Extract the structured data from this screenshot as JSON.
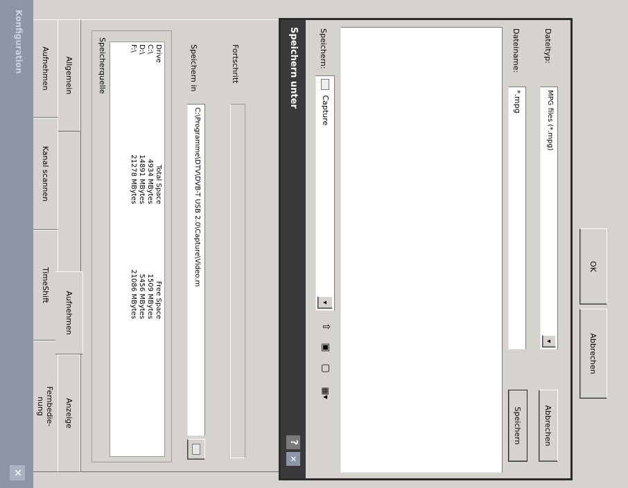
{
  "window": {
    "title": "Konfiguration",
    "close_glyph": "✕"
  },
  "tabs_row1": [
    {
      "label": "Aufnehmen"
    },
    {
      "label": "Kanal scannen"
    },
    {
      "label": "TimeShift"
    },
    {
      "label": "Fernbedienung",
      "display": "Fernbedie-\nnung"
    }
  ],
  "tabs_row2": [
    {
      "label": "Allgemein"
    },
    {
      "label": "Aufnehmen"
    },
    {
      "label": "Anzeige"
    }
  ],
  "speicherquelle": {
    "legend": "Speicherquelle",
    "headers": [
      "Drive",
      "Total Space",
      "Free Space"
    ],
    "rows": [
      [
        "C:\\",
        "4934 MBytes",
        "1509 MBytes"
      ],
      [
        "D:\\",
        "14891 MBytes",
        "5456 MBytes"
      ],
      [
        "F:\\",
        "21278 MBytes",
        "21086 MBytes"
      ]
    ]
  },
  "speichern_in": {
    "label": "Speichern in",
    "value": "C:\\Programme\\DTV\\DVB-T USB 2.0\\Capture\\Video.m"
  },
  "fortschritt": {
    "label": "Fortschritt"
  },
  "ok_button": "OK",
  "cancel_button": "Abbrechen",
  "save_dialog": {
    "title": "Speichern unter",
    "help_glyph": "?",
    "close_glyph": "✕",
    "save_in_label": "Speichern:",
    "save_in_value": "Capture",
    "dropdown_glyph": "▾",
    "toolbar": {
      "up": "⇧",
      "new_folder": "▣",
      "desktop": "▢",
      "view": "▦▾"
    },
    "filename_label": "Dateiname:",
    "filename_value": "*.mpg",
    "filetype_label": "Dateityp:",
    "filetype_value": "MPG files (*.mpg)",
    "save_button": "Speichern",
    "cancel_button": "Abbrechen"
  }
}
